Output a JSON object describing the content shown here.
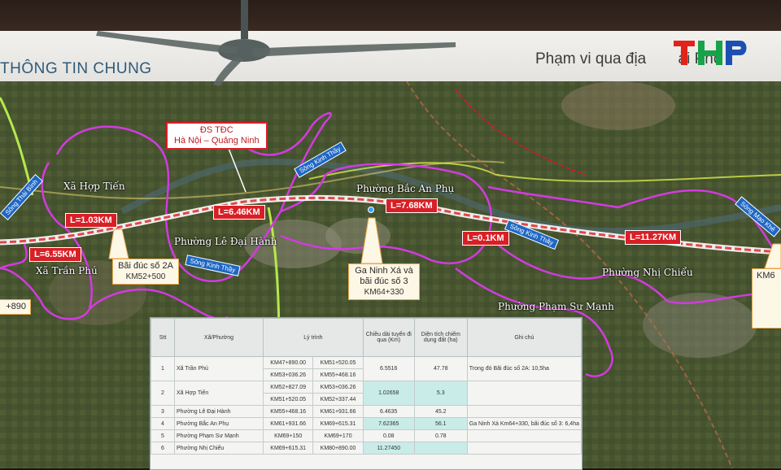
{
  "header": {
    "left_title": "THÔNG TIN CHUNG",
    "right_title": "Phạm vi qua địa",
    "right_title_tail": "ải Phò"
  },
  "logo": {
    "text": "THP",
    "colors": [
      "#e2231a",
      "#17a34a",
      "#1d4fb3"
    ]
  },
  "map": {
    "wards": [
      "Xã Hợp Tiến",
      "Phường Lê Đại Hành",
      "Phường Bắc An Phụ",
      "Xã Trần Phú",
      "Phường Nhị Chiểu",
      "Phường Phạm Sư Mạnh"
    ],
    "lengths": [
      "L=1.03KM",
      "L=6.55KM",
      "L=6.46KM",
      "L=7.68KM",
      "L=0.1KM",
      "L=11.27KM"
    ],
    "rivers": [
      "Sông Kinh Thầy",
      "Sông Kinh Thầy",
      "Sông Kinh Thầy",
      "Sông Thái Bình",
      "Sông Mạo Khê"
    ],
    "railway_label": {
      "line1": "ĐS TĐC",
      "line2": "Hà Nội – Quảng Ninh"
    },
    "callouts": [
      {
        "title": "Bãi đúc số 2A",
        "km": "KM52+500"
      },
      {
        "title": "Ga Ninh Xá và bãi đúc số 3",
        "km": "KM64+330"
      }
    ],
    "edge_left": "+890",
    "edge_right": "KM6"
  },
  "table": {
    "headers": {
      "stt": "Stt",
      "ward": "Xã/Phường",
      "range": "Lý trình",
      "length": "Chiều dài tuyến đi qua (Km)",
      "area": "Diện tích chiếm dụng đất (ha)",
      "note": "Ghi chú"
    },
    "rows": [
      {
        "stt": "1",
        "ward": "Xã Trần Phú",
        "r1a": "KM47+890.00",
        "r1b": "KM51+520.05",
        "r2a": "KM53+036.26",
        "r2b": "KM55+468.16",
        "len": "6.5516",
        "area": "47.78",
        "note": "Trong đó Bãi đúc số 2A: 10,5ha"
      },
      {
        "stt": "2",
        "ward": "Xã Hợp Tiến",
        "r1a": "KM52+827.09",
        "r1b": "KM53+036.26",
        "r2a": "KM51+520.05",
        "r2b": "KM52+337.44",
        "len": "1.02658",
        "area": "5.3",
        "note": ""
      },
      {
        "stt": "3",
        "ward": "Phường Lê Đại Hành",
        "r1a": "KM55+468.16",
        "r1b": "KM61+931.66",
        "len": "6.4635",
        "area": "45.2",
        "note": ""
      },
      {
        "stt": "4",
        "ward": "Phường Bắc An Phụ",
        "r1a": "KM61+931.66",
        "r1b": "KM69+615.31",
        "len": "7.62365",
        "area": "56.1",
        "note": "Ga Ninh Xá Km64+330, bãi đúc số 3: 6,4ha"
      },
      {
        "stt": "5",
        "ward": "Phường Phạm Sư Mạnh",
        "r1a": "KM69+150",
        "r1b": "KM69+170",
        "len": "0.08",
        "area": "0.78",
        "note": ""
      },
      {
        "stt": "6",
        "ward": "Phường Nhị Chiểu",
        "r1a": "KM69+615.31",
        "r1b": "KM80+890.00",
        "len": "11.27450",
        "area": "",
        "note": ""
      }
    ]
  }
}
